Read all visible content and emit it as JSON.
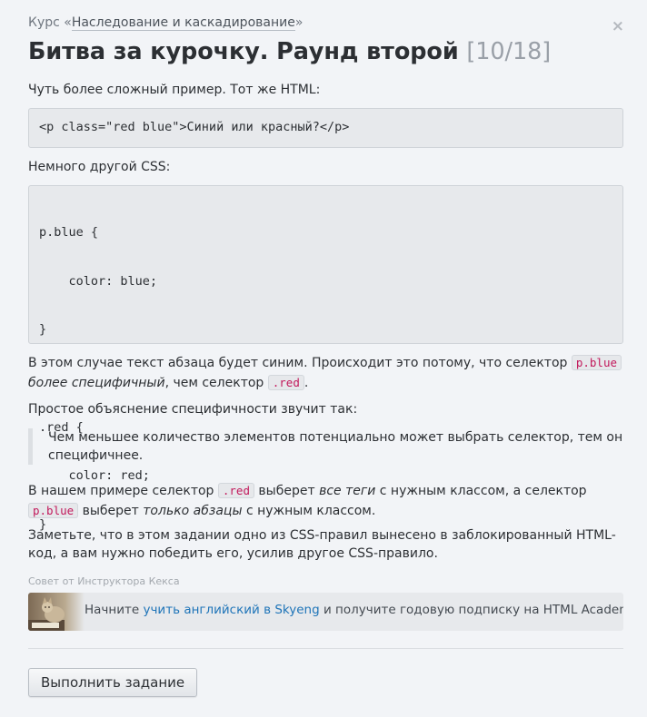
{
  "breadcrumb": {
    "prefix": "Курс «",
    "course_link": "Наследование и каскадирование",
    "suffix": "»"
  },
  "close_glyph": "×",
  "task": {
    "title": "Битва за курочку. Раунд второй",
    "counter": "[10/18]"
  },
  "content": {
    "intro": "Чуть более сложный пример. Тот же HTML:",
    "html_code": "<p class=\"red blue\">Синий или красный?</p>",
    "css_intro": "Немного другой CSS:",
    "css_code_lines": [
      "p.blue {",
      "    color: blue;",
      "}",
      "",
      ".red {",
      "    color: red;",
      "}"
    ],
    "explanation": {
      "part1": "В этом случае текст абзаца будет синим. Происходит это потому, что селектор ",
      "code1": "p.blue",
      "emph": "более специфичный",
      "part2": ", чем селектор ",
      "code2": ".red",
      "part3": "."
    },
    "simple_intro": "Простое объяснение специфичности звучит так:",
    "quote": "Чем меньшее количество элементов потенциально может выбрать селектор, тем он специфичнее.",
    "example": {
      "part1": "В нашем примере селектор ",
      "code1": ".red",
      "part2": " выберет ",
      "emph1": "все теги",
      "part3": " с нужным классом, а селектор ",
      "code2": "p.blue",
      "part4": " выберет ",
      "emph2": "только абзацы",
      "part5": " с нужным классом."
    },
    "note": "Заметьте, что в этом задании одно из CSS-правил вынесено в заблокированный HTML-код, а вам нужно победить его, усилив другое CSS-правило."
  },
  "tip": {
    "label": "Совет от Инструктора Кекса",
    "text_before": "Начните ",
    "link": "учить английский в Skyeng",
    "text_after": " и получите годовую подписку на HTML Academy!",
    "image_icon": "cat-photo"
  },
  "action": {
    "button_label": "Выполнить задание"
  }
}
